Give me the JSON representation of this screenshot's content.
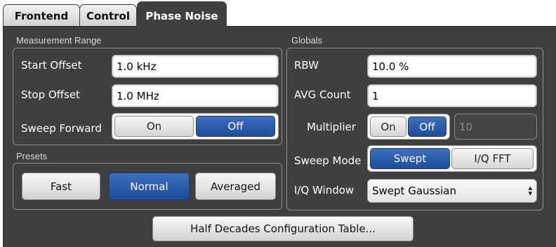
{
  "tabs": {
    "frontend": "Frontend",
    "control": "Control",
    "phase_noise": "Phase Noise"
  },
  "measurement_range": {
    "title": "Measurement Range",
    "start_offset": {
      "label": "Start Offset",
      "value": "1.0 kHz"
    },
    "stop_offset": {
      "label": "Stop Offset",
      "value": "1.0 MHz"
    },
    "sweep_forward": {
      "label": "Sweep Forward",
      "on": "On",
      "off": "Off",
      "selected": "Off"
    }
  },
  "presets": {
    "title": "Presets",
    "fast": "Fast",
    "normal": "Normal",
    "averaged": "Averaged",
    "selected": "Normal"
  },
  "globals": {
    "title": "Globals",
    "rbw": {
      "label": "RBW",
      "value": "10.0 %"
    },
    "avg_count": {
      "label": "AVG Count",
      "value": "1"
    },
    "multiplier": {
      "label": "Multiplier",
      "on": "On",
      "off": "Off",
      "selected": "Off",
      "value": "10"
    },
    "sweep_mode": {
      "label": "Sweep Mode",
      "swept": "Swept",
      "iq_fft": "I/Q FFT",
      "selected": "Swept"
    },
    "iq_window": {
      "label": "I/Q Window",
      "value": "Swept Gaussian"
    }
  },
  "half_decades_button": "Half Decades Configuration Table...",
  "icons": {
    "select_arrows": "up-down-arrows-icon"
  },
  "colors": {
    "panel_bg": "#3f3f3f",
    "accent_blue": "#2a5cab"
  }
}
